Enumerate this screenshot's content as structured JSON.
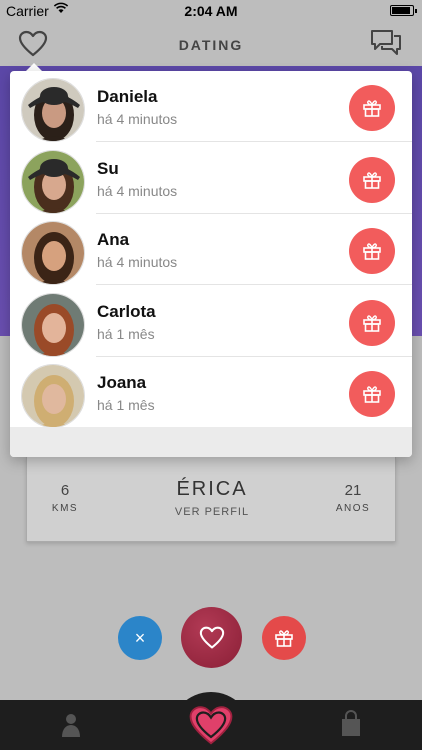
{
  "status_bar": {
    "carrier": "Carrier",
    "time": "2:04 AM"
  },
  "nav": {
    "title": "DATING"
  },
  "profile": {
    "name": "ÉRICA",
    "link": "VER PERFIL",
    "distance_value": "6",
    "distance_unit": "KMS",
    "age_value": "21",
    "age_unit": "ANOS"
  },
  "action_buttons": {
    "dismiss_glyph": "×"
  },
  "notifications": [
    {
      "name": "Daniela",
      "time": "há 4 minutos",
      "skin": "#c99a82",
      "hair": "#2b2019",
      "bg": "#cfcabe",
      "hat": "#2a2a2a"
    },
    {
      "name": "Su",
      "time": "há 4 minutos",
      "skin": "#d7a88e",
      "hair": "#4a2e1d",
      "bg": "#8ca35d",
      "hat": "#2a2a2a"
    },
    {
      "name": "Ana",
      "time": "há 4 minutos",
      "skin": "#d6a17e",
      "hair": "#3b2416",
      "bg": "#b48866",
      "hat": ""
    },
    {
      "name": "Carlota",
      "time": "há 1 mês",
      "skin": "#e3b49a",
      "hair": "#9a4a28",
      "bg": "#6f7b74",
      "hat": ""
    },
    {
      "name": "Joana",
      "time": "há 1 mês",
      "skin": "#e0b89e",
      "hair": "#cfae72",
      "bg": "#d4c9b0",
      "hat": ""
    }
  ],
  "colors": {
    "accent_red": "#f25c5c",
    "purple": "#5c48a8",
    "dismiss_blue": "#2b85c9",
    "like_crimson": "#9c2a45"
  }
}
